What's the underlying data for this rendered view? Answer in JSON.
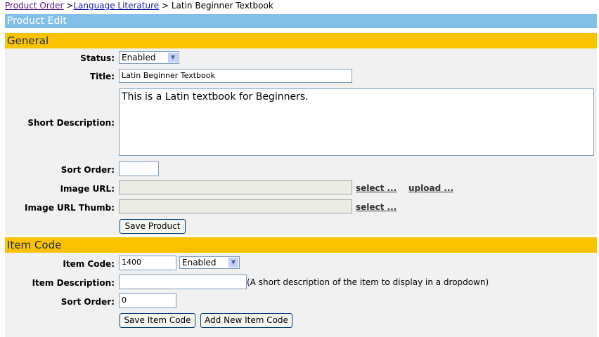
{
  "breadcrumb": {
    "item1": "Product Order",
    "sep1": " >",
    "item2": "Language Literature",
    "sep2": " > ",
    "current": "Latin Beginner Textbook"
  },
  "page_title": "Product Edit",
  "general": {
    "header": "General",
    "status_label": "Status:",
    "status_value": "Enabled",
    "title_label": "Title:",
    "title_value": "Latin Beginner Textbook",
    "short_desc_label": "Short Description:",
    "short_desc_value": "This is a Latin textbook for Beginners.",
    "sort_order_label": "Sort Order:",
    "sort_order_value": "",
    "image_url_label": "Image URL:",
    "image_url_value": "",
    "image_url_thumb_label": "Image URL Thumb:",
    "image_url_thumb_value": "",
    "select_link": "select ...",
    "upload_link": "upload ...",
    "select_link_thumb": "select ...",
    "save_button": "Save Product"
  },
  "item_code": {
    "header": "Item Code",
    "code_label": "Item Code:",
    "code_value": "1400",
    "status_value": "Enabled",
    "desc_label": "Item Description:",
    "desc_value": "",
    "desc_hint": "(A short description of the item to display in a dropdown)",
    "sort_order_label": "Sort Order:",
    "sort_order_value": "0",
    "save_button": "Save Item Code",
    "add_button": "Add New Item Code"
  },
  "colors": {
    "title_bar": "#82c0e8",
    "section_header": "#f9c300",
    "panel_bg": "#f1f1f1"
  }
}
